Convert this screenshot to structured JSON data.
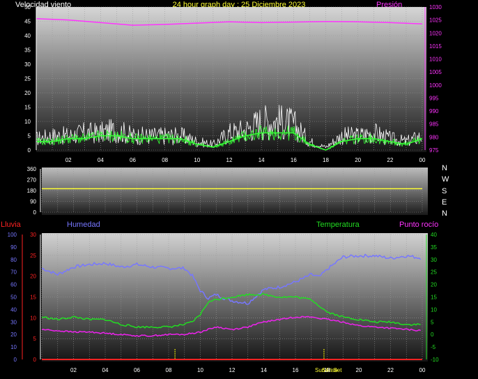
{
  "header": {
    "left_title": "Velocidad viento",
    "center_title": "24 hour graph day : 25 Diciembre 2023",
    "right_title": "Presión"
  },
  "labels": {
    "lluvia": "Lluvia",
    "humedad": "Humedad",
    "temperatura": "Temperatura",
    "punto_rocio": "Punto rocío",
    "sunrise": "Sun Rise",
    "sunset": "Sun Set"
  },
  "compass": [
    "N",
    "W",
    "S",
    "E",
    "N"
  ],
  "colors": {
    "wind_gust": "#ffffff",
    "wind_avg": "#33ff33",
    "wind_avg_line": "#ffff99",
    "pressure": "#ff33ff",
    "direction_line": "#ffff33",
    "rain": "#ff2222",
    "humidity": "#7777ff",
    "temperature": "#22dd22",
    "dewpoint": "#ee22ee",
    "sun_marker": "#ffff00"
  },
  "chart_data": [
    {
      "type": "line",
      "name": "wind-pressure",
      "x_tick_labels": [
        "02",
        "04",
        "06",
        "08",
        "10",
        "12",
        "14",
        "16",
        "18",
        "20",
        "22",
        "00"
      ],
      "y_left_ticks": [
        "0",
        "5",
        "10",
        "15",
        "20",
        "25",
        "30",
        "35",
        "40",
        "45",
        "50"
      ],
      "y_right_ticks": [
        "975",
        "980",
        "985",
        "990",
        "995",
        "1000",
        "1005",
        "1010",
        "1015",
        "1020",
        "1025",
        "1030"
      ],
      "ylim_left": [
        0,
        50
      ],
      "ylim_right": [
        975,
        1030
      ],
      "grid": true,
      "series": [
        {
          "role": "wind_gust",
          "x": [
            0,
            1,
            2,
            3,
            4,
            5,
            6,
            7,
            8,
            9,
            10,
            11,
            12,
            13,
            14,
            15,
            16,
            17,
            18,
            19,
            20,
            21,
            22,
            23,
            24
          ],
          "values": [
            4,
            5,
            5,
            6,
            6,
            7,
            5,
            5,
            5,
            5,
            3,
            2,
            6,
            7,
            10,
            10,
            9,
            3,
            1,
            5,
            5,
            6,
            4,
            3,
            5
          ]
        },
        {
          "role": "wind_avg",
          "x": [
            0,
            1,
            2,
            3,
            4,
            5,
            6,
            7,
            8,
            9,
            10,
            11,
            12,
            13,
            14,
            15,
            16,
            17,
            18,
            19,
            20,
            21,
            22,
            23,
            24
          ],
          "values": [
            3,
            3,
            4,
            4,
            5,
            5,
            4,
            4,
            4,
            4,
            2,
            1,
            3,
            5,
            6,
            6,
            6,
            2,
            0,
            3,
            4,
            4,
            3,
            2,
            4
          ]
        },
        {
          "role": "pressure",
          "x": [
            0,
            2,
            4,
            6,
            8,
            10,
            12,
            14,
            16,
            18,
            20,
            22,
            24
          ],
          "values": [
            1025.5,
            1025.0,
            1024.0,
            1023.0,
            1023.3,
            1023.8,
            1024.3,
            1024.0,
            1024.2,
            1024.4,
            1024.3,
            1024.0,
            1023.5
          ]
        }
      ]
    },
    {
      "type": "line",
      "name": "wind-direction",
      "y_ticks": [
        "0",
        "90",
        "180",
        "270",
        "360"
      ],
      "ylim": [
        0,
        360
      ],
      "series": [
        {
          "role": "direction",
          "x": [
            0,
            24
          ],
          "values": [
            195,
            195
          ]
        }
      ]
    },
    {
      "type": "line",
      "name": "temp-humidity",
      "y_rain_ticks": [
        "0",
        "5",
        "10",
        "15",
        "20",
        "25",
        "30"
      ],
      "y_humidity_ticks": [
        "0",
        "10",
        "20",
        "30",
        "40",
        "50",
        "60",
        "70",
        "80",
        "90",
        "100"
      ],
      "y_temp_ticks": [
        "-10",
        "-5",
        "0",
        "5",
        "10",
        "15",
        "20",
        "25",
        "30",
        "35",
        "40"
      ],
      "ylim_rain": [
        0,
        30
      ],
      "ylim_humidity": [
        0,
        100
      ],
      "ylim_temp": [
        -10,
        40
      ],
      "sunrise_hour": 8.4,
      "sunset_hour": 17.8,
      "series": [
        {
          "role": "humidity",
          "x": [
            0,
            1,
            2,
            3,
            4,
            5,
            6,
            7,
            8,
            9,
            9.5,
            10,
            10.5,
            11,
            11.5,
            12,
            13,
            14,
            15,
            16,
            17,
            17.5,
            18,
            19,
            20,
            21,
            22,
            23,
            24
          ],
          "values": [
            73,
            68,
            74,
            76,
            77,
            74,
            76,
            74,
            73,
            73,
            67,
            55,
            49,
            52,
            49,
            47,
            45,
            56,
            58,
            62,
            68,
            66,
            72,
            82,
            83,
            83,
            81,
            83,
            81
          ]
        },
        {
          "role": "temperature",
          "x": [
            0,
            1,
            2,
            3,
            4,
            5,
            6,
            7,
            8,
            9,
            9.5,
            10,
            10.5,
            11,
            12,
            13,
            14,
            15,
            16,
            17,
            18,
            19,
            20,
            21,
            22,
            23,
            24
          ],
          "values": [
            7,
            6,
            7,
            6,
            6,
            4,
            3,
            3,
            3,
            4,
            5,
            8,
            13,
            14,
            15,
            16,
            16,
            15,
            15,
            14,
            9,
            7,
            6,
            5,
            5,
            4,
            4
          ]
        },
        {
          "role": "dewpoint",
          "x": [
            0,
            1,
            2,
            3,
            4,
            5,
            6,
            7,
            8,
            9,
            10,
            10.5,
            11,
            12,
            13,
            14,
            15,
            16,
            17,
            18,
            19,
            20,
            21,
            22,
            23,
            24
          ],
          "values": [
            2,
            1.5,
            1,
            1,
            0.5,
            0,
            -0.5,
            -0.5,
            0,
            0,
            1,
            2,
            3,
            2,
            3,
            5,
            6,
            7,
            7,
            6,
            5,
            3.5,
            3,
            2.5,
            2,
            1.5
          ]
        },
        {
          "role": "rain",
          "x": [
            0,
            24
          ],
          "values": [
            0,
            0
          ]
        }
      ]
    }
  ]
}
